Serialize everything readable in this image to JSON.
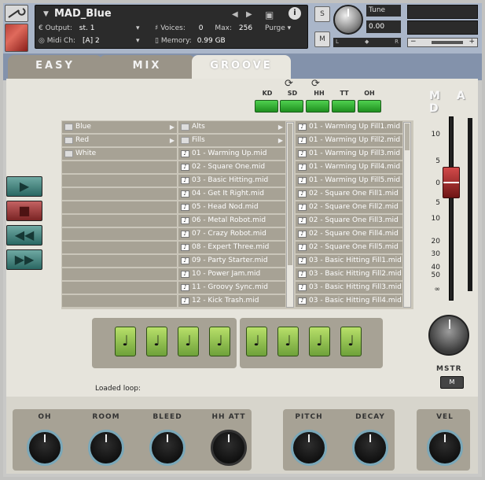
{
  "header": {
    "instrument_name": "MAD_Blue",
    "output_label": "Output:",
    "output_value": "st. 1",
    "voices_label": "Voices:",
    "voices_value": "0",
    "max_label": "Max:",
    "max_value": "256",
    "purge_label": "Purge",
    "midi_label": "Midi Ch:",
    "midi_value": "[A] 2",
    "memory_label": "Memory:",
    "memory_value": "0.99 GB",
    "solo_label": "S",
    "mute_label": "M",
    "tune_label": "Tune",
    "tune_value": "0.00",
    "pan_left": "L",
    "pan_right": "R"
  },
  "tabs": [
    {
      "label": "EASY",
      "active": false
    },
    {
      "label": "MIX",
      "active": false
    },
    {
      "label": "GROOVE",
      "active": true
    }
  ],
  "kit": {
    "labels": [
      "KD",
      "SD",
      "HH",
      "TT",
      "OH"
    ],
    "logo": "M A D"
  },
  "browser": {
    "folders": [
      "Blue",
      "Red",
      "White"
    ],
    "categories": [
      "Alts",
      "Fills"
    ],
    "grooves": [
      "01 - Warming Up.mid",
      "02 - Square One.mid",
      "03 - Basic Hitting.mid",
      "04 - Get It Right.mid",
      "05 - Head Nod.mid",
      "06 - Metal Robot.mid",
      "07 - Crazy Robot.mid",
      "08 - Expert Three.mid",
      "09 - Party Starter.mid",
      "10 - Power Jam.mid",
      "11 - Groovy Sync.mid",
      "12 - Kick Trash.mid"
    ],
    "fills": [
      "01 - Warming Up Fill1.mid",
      "01 - Warming Up Fill2.mid",
      "01 - Warming Up Fill3.mid",
      "01 - Warming Up Fill4.mid",
      "01 - Warming Up Fill5.mid",
      "02 - Square One Fill1.mid",
      "02 - Square One Fill2.mid",
      "02 - Square One Fill3.mid",
      "02 - Square One Fill4.mid",
      "02 - Square One Fill5.mid",
      "03 - Basic Hitting Fill1.mid",
      "03 - Basic Hitting Fill2.mid",
      "03 - Basic Hitting Fill3.mid",
      "03 - Basic Hitting Fill4.mid"
    ]
  },
  "fader": {
    "scale": [
      "10",
      "5",
      "0",
      "5",
      "10",
      "20",
      "30",
      "40",
      "50",
      "∞"
    ]
  },
  "master": {
    "label": "MSTR",
    "mute": "M"
  },
  "loaded": {
    "label": "Loaded loop:"
  },
  "beat_glyph": "♩",
  "knobs": [
    {
      "label": "OH"
    },
    {
      "label": "ROOM"
    },
    {
      "label": "BLEED"
    },
    {
      "label": "HH ATT"
    },
    {
      "label": "PITCH"
    },
    {
      "label": "DECAY"
    },
    {
      "label": "VEL"
    }
  ],
  "colors": {
    "accent_green": "#2fae2f",
    "transport_teal": "#2a6762",
    "stop_red": "#7a2424",
    "panel_bg": "#e6e4dc",
    "list_bg": "#a7a295",
    "header_blue": "#aab6c9"
  }
}
